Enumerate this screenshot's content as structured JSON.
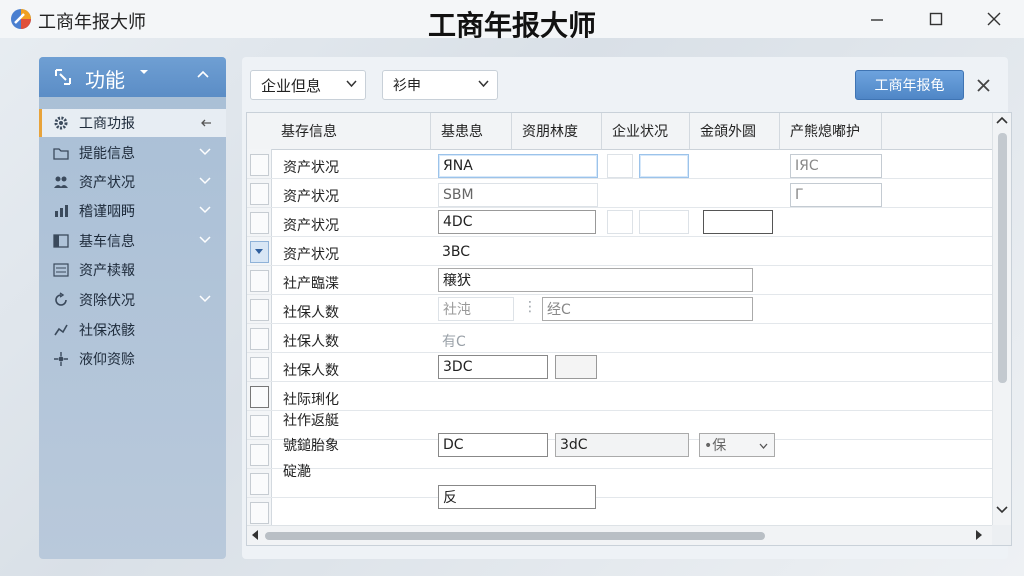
{
  "app": {
    "name": "工商年报大师",
    "window_title": "工商年报大师"
  },
  "sidebar": {
    "header_label": "功能",
    "items": [
      {
        "label": "工商功报",
        "icon": "gear-icon",
        "active": true,
        "has_chevron": false
      },
      {
        "label": "提能信息",
        "icon": "folder-icon",
        "active": false,
        "has_chevron": true
      },
      {
        "label": "资产状况",
        "icon": "users-icon",
        "active": false,
        "has_chevron": true
      },
      {
        "label": "稽谨咽眄",
        "icon": "chart-icon",
        "active": false,
        "has_chevron": true
      },
      {
        "label": "基车信息",
        "icon": "panel-icon",
        "active": false,
        "has_chevron": true
      },
      {
        "label": "资产椟報",
        "icon": "list-icon",
        "active": false,
        "has_chevron": false
      },
      {
        "label": "资除伏况",
        "icon": "refresh-icon",
        "active": false,
        "has_chevron": true
      },
      {
        "label": "社保浓骸",
        "icon": "flow-icon",
        "active": false,
        "has_chevron": false
      },
      {
        "label": "液仰资赊",
        "icon": "network-icon",
        "active": false,
        "has_chevron": false
      }
    ]
  },
  "toolbar": {
    "category_select": "企业但息",
    "sub_select": "衫申",
    "report_button": "工商年报龟"
  },
  "grid": {
    "columns": [
      "基存信息",
      "基患息",
      "资朋林度",
      "企业状况",
      "金頜外圆",
      "产熊熄嘟护"
    ],
    "rows": [
      {
        "label": "资产状况"
      },
      {
        "label": "资产状况"
      },
      {
        "label": "资产状况"
      },
      {
        "label": "资产状况",
        "current": true
      },
      {
        "label": "社产臨渫"
      },
      {
        "label": "社保人数"
      },
      {
        "label": "社保人数"
      },
      {
        "label": "社保人数"
      },
      {
        "label": "社际琍化",
        "checkbox": true
      },
      {
        "label": "社作返艇"
      },
      {
        "label": "號鎚胎象"
      },
      {
        "label": "碇濪"
      },
      {
        "label": ""
      },
      {
        "label": ""
      }
    ],
    "cells": {
      "r1_c1": "ЯNA",
      "r1_c6": "ΙЯC",
      "r2_c1": "SBM",
      "r2_c6": "Γ",
      "r3_c1": "4DC",
      "r4_c1": "3BC",
      "r5_c1": "穣犾",
      "r6_c1": "社沌",
      "r6_c2": "经C",
      "r7_c1": "有C",
      "r8_c1": "3DC",
      "r11_c1": "DC",
      "r11_c2": "3dC",
      "r11_c4": "•保",
      "r13_c1": "反"
    }
  },
  "colors": {
    "accent": "#5b8dc6",
    "sidebar_bg": "#b3c5d8",
    "active_marker": "#e8a33a"
  }
}
